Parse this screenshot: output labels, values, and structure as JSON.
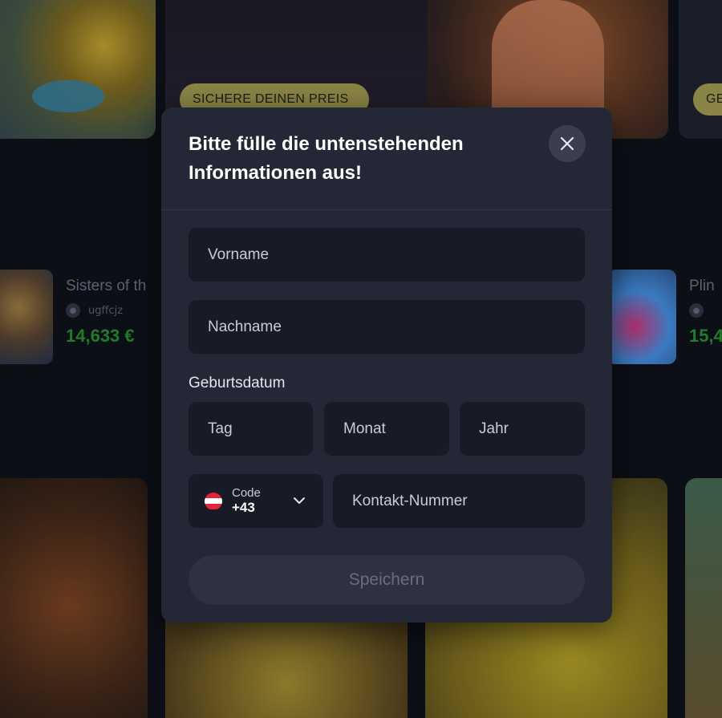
{
  "background": {
    "promo_buttons": [
      "SICHERE DEINEN PREIS",
      "GE"
    ],
    "games": [
      {
        "name": "Sisters of th",
        "user": "ugffcjz",
        "amount": "14,633 €"
      },
      {
        "name": "Plin",
        "user": "",
        "amount": "15,4"
      }
    ]
  },
  "modal": {
    "title": "Bitte fülle die untenstehenden Informationen aus!",
    "close_icon": "close-icon",
    "fields": {
      "first_name_placeholder": "Vorname",
      "last_name_placeholder": "Nachname",
      "birthdate_label": "Geburtsdatum",
      "day_placeholder": "Tag",
      "month_placeholder": "Monat",
      "year_placeholder": "Jahr",
      "phone_code_label": "Code",
      "phone_code_value": "+43",
      "phone_placeholder": "Kontakt-Nummer"
    },
    "save_label": "Speichern"
  },
  "colors": {
    "modal_bg": "#242735",
    "field_bg": "#181a25",
    "save_disabled_bg": "#2d3140",
    "flag_red": "#e4233b",
    "flag_white": "#ffffff"
  }
}
